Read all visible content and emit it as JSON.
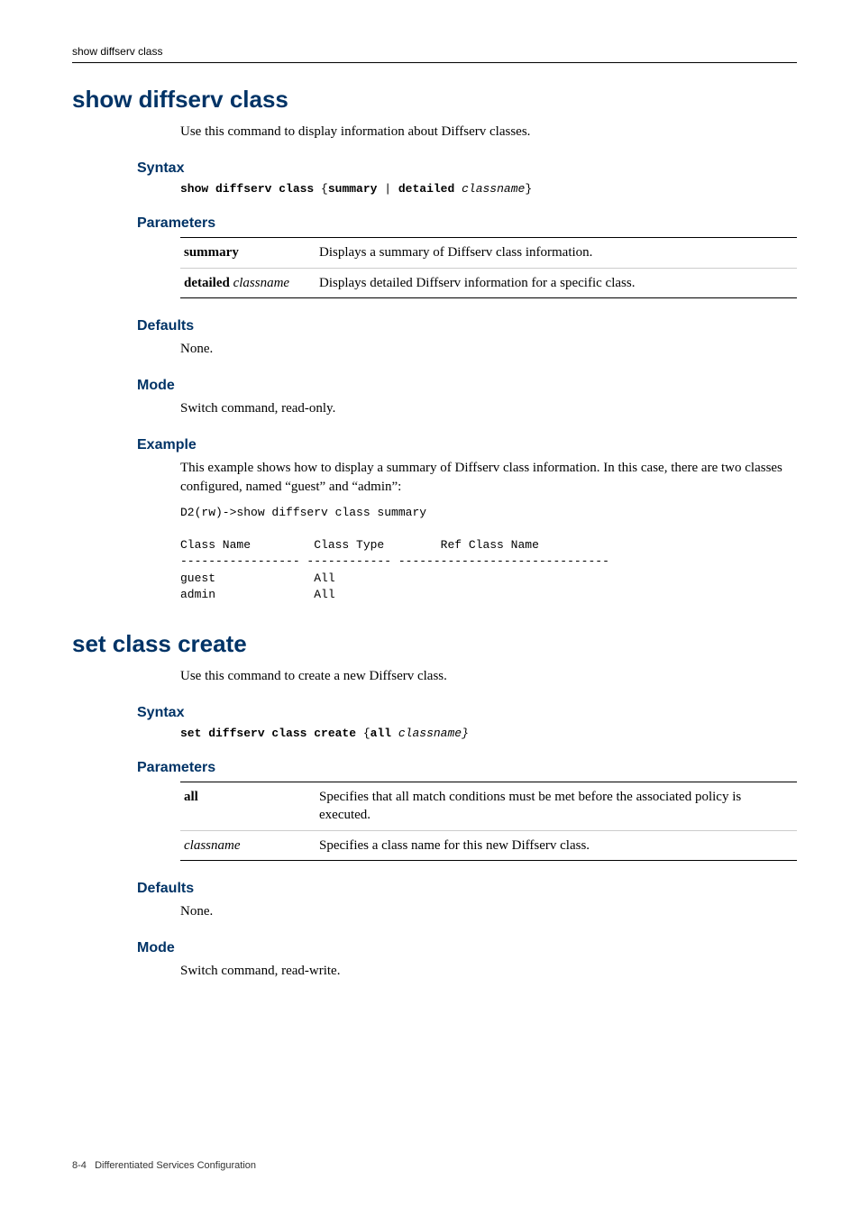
{
  "header": {
    "running_head": "show diffserv class"
  },
  "sections": [
    {
      "title": "show diffserv class",
      "intro": "Use this command to display information about Diffserv classes.",
      "syntax_heading": "Syntax",
      "syntax_parts": {
        "p1": "show diffserv class",
        "p2": " {",
        "p3": "summary",
        "p4": " | ",
        "p5": "detailed",
        "p6": " ",
        "p7": "classname",
        "p8": "}"
      },
      "parameters_heading": "Parameters",
      "params": [
        {
          "key_bold": "summary",
          "key_italic": "",
          "desc": "Displays a summary of Diffserv class information."
        },
        {
          "key_bold": "detailed",
          "key_italic": " classname",
          "desc": "Displays detailed Diffserv information for a specific class."
        }
      ],
      "defaults_heading": "Defaults",
      "defaults_text": "None.",
      "mode_heading": "Mode",
      "mode_text": "Switch command, read-only.",
      "example_heading": "Example",
      "example_text": "This example shows how to display a summary of Diffserv class information. In this case, there are two classes configured, named “guest” and “admin”:",
      "example_output": "D2(rw)->show diffserv class summary\n\nClass Name         Class Type        Ref Class Name\n----------------- ------------ ------------------------------\nguest              All\nadmin              All"
    },
    {
      "title": "set class create",
      "intro": "Use this command to create a new Diffserv class.",
      "syntax_heading": "Syntax",
      "syntax_parts": {
        "p1": "set diffserv class create",
        "p2": " {",
        "p3": "all",
        "p4": " ",
        "p5": "",
        "p6": "",
        "p7": "classname}",
        "p8": ""
      },
      "parameters_heading": "Parameters",
      "params": [
        {
          "key_bold": "all",
          "key_italic": "",
          "desc": "Specifies that all match conditions must be met before the associated policy is executed."
        },
        {
          "key_bold": "",
          "key_italic": "classname",
          "desc": "Specifies a class name for this new Diffserv class."
        }
      ],
      "defaults_heading": "Defaults",
      "defaults_text": "None.",
      "mode_heading": "Mode",
      "mode_text": "Switch command, read-write."
    }
  ],
  "footer": {
    "page": "8-4",
    "chapter": "Differentiated Services Configuration"
  }
}
